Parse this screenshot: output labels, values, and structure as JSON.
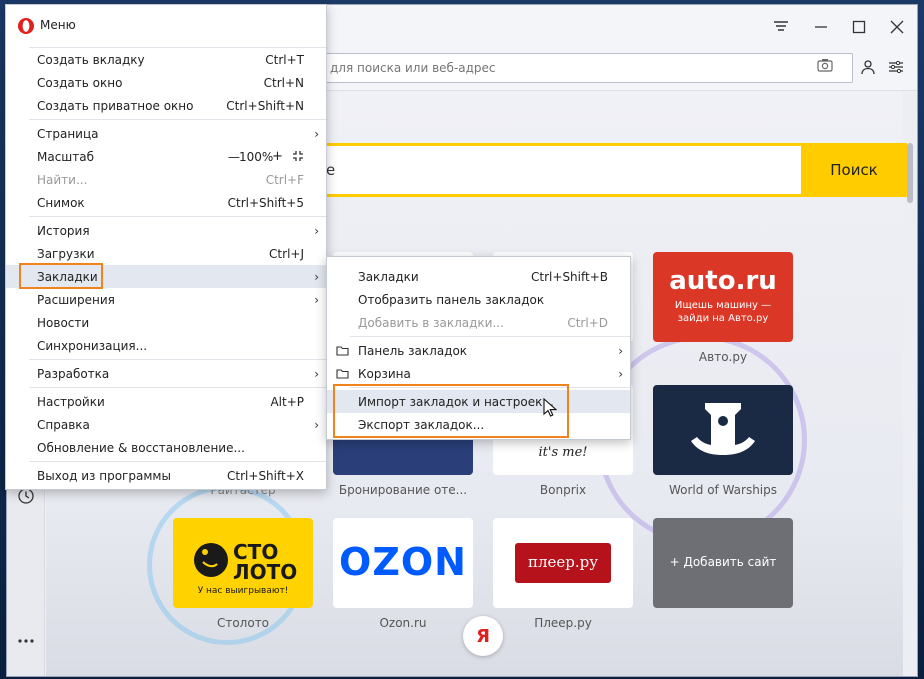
{
  "window": {
    "address_placeholder": "для поиска или веб-адрес"
  },
  "search": {
    "input_fragment": "e",
    "button_label": "Поиск"
  },
  "menu": {
    "title": "Меню",
    "items": [
      {
        "label": "Создать вкладку",
        "shortcut": "Ctrl+T"
      },
      {
        "label": "Создать окно",
        "shortcut": "Ctrl+N"
      },
      {
        "label": "Создать приватное окно",
        "shortcut": "Ctrl+Shift+N"
      },
      {
        "label": "Страница"
      },
      {
        "label": "Масштаб",
        "zoom_minus": "—",
        "zoom_value": "100%",
        "zoom_plus": "+"
      },
      {
        "label": "Найти...",
        "shortcut": "Ctrl+F"
      },
      {
        "label": "Снимок",
        "shortcut": "Ctrl+Shift+5"
      },
      {
        "label": "История"
      },
      {
        "label": "Загрузки",
        "shortcut": "Ctrl+J"
      },
      {
        "label": "Закладки"
      },
      {
        "label": "Расширения"
      },
      {
        "label": "Новости"
      },
      {
        "label": "Синхронизация..."
      },
      {
        "label": "Разработка"
      },
      {
        "label": "Настройки",
        "shortcut": "Alt+P"
      },
      {
        "label": "Справка"
      },
      {
        "label": "Обновление & восстановление..."
      },
      {
        "label": "Выход из программы",
        "shortcut": "Ctrl+Shift+X"
      }
    ]
  },
  "submenu": {
    "items": [
      {
        "label": "Закладки",
        "shortcut": "Ctrl+Shift+B"
      },
      {
        "label": "Отобразить панель закладок"
      },
      {
        "label": "Добавить в закладки...",
        "shortcut": "Ctrl+D"
      },
      {
        "label": "Панель закладок"
      },
      {
        "label": "Корзина"
      },
      {
        "label": "Импорт закладок и настроек..."
      },
      {
        "label": "Экспорт закладок..."
      }
    ]
  },
  "tiles": {
    "auto": {
      "logo": "auto.ru",
      "tagline1": "Ищешь машину —",
      "tagline2": "зайди на Авто.ру",
      "label": "Авто.ру"
    },
    "booking": {
      "label": "Бронирование оте..."
    },
    "bonprix": {
      "logo_fragment": "it's me!",
      "label": "Bonprix"
    },
    "wows": {
      "label": "World of Warships"
    },
    "partial": {
      "label": "Райтастер"
    },
    "stoloto": {
      "logo1": "СТО",
      "logo2": "ЛОТО",
      "tagline": "У нас выигрывают!",
      "label": "Столото"
    },
    "ozon": {
      "logo": "OZON",
      "label": "Ozon.ru"
    },
    "pleer": {
      "logo": "плеер.ру",
      "label": "Плеер.ру"
    },
    "add": {
      "label": "+ Добавить сайт"
    }
  },
  "yandex_badge": "Я",
  "colors": {
    "accent_orange": "#f0831e",
    "search_yellow": "#ffcc00",
    "auto_red": "#db3727",
    "wows_navy": "#1b2a44",
    "ozon_blue": "#005bff",
    "opera_red": "#e0201d"
  },
  "icons": {
    "opera": "opera-logo-icon",
    "folder": "folder-icon",
    "fullscreen": "fullscreen-icon",
    "cursor": "mouse-cursor-icon"
  }
}
